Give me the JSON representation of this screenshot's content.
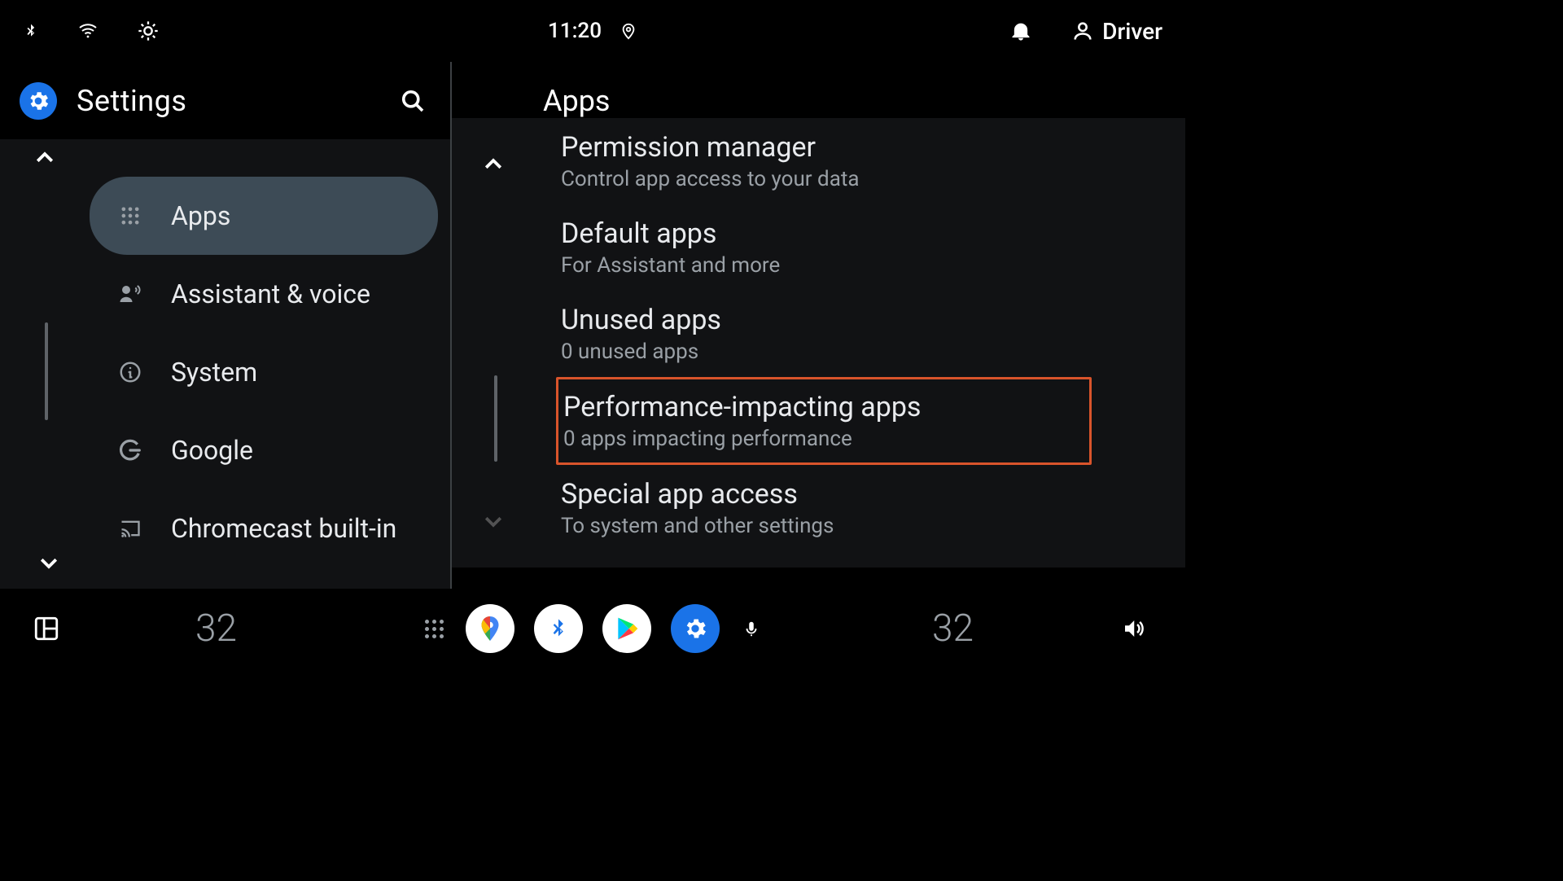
{
  "status_bar": {
    "time": "11:20",
    "driver_label": "Driver"
  },
  "left_pane": {
    "title": "Settings",
    "items": [
      {
        "label": "Apps",
        "active": true
      },
      {
        "label": "Assistant & voice",
        "active": false
      },
      {
        "label": "System",
        "active": false
      },
      {
        "label": "Google",
        "active": false
      },
      {
        "label": "Chromecast built-in",
        "active": false
      }
    ]
  },
  "right_pane": {
    "title": "Apps",
    "items": [
      {
        "title": "Permission manager",
        "sub": "Control app access to your data",
        "partial_top": true
      },
      {
        "title": "Default apps",
        "sub": "For Assistant and more"
      },
      {
        "title": "Unused apps",
        "sub": "0 unused apps"
      },
      {
        "title": "Performance-impacting apps",
        "sub": "0 apps impacting performance",
        "highlight": true
      },
      {
        "title": "Special app access",
        "sub": "To system and other settings"
      }
    ]
  },
  "dock": {
    "temp_left": "32",
    "temp_right": "32"
  }
}
